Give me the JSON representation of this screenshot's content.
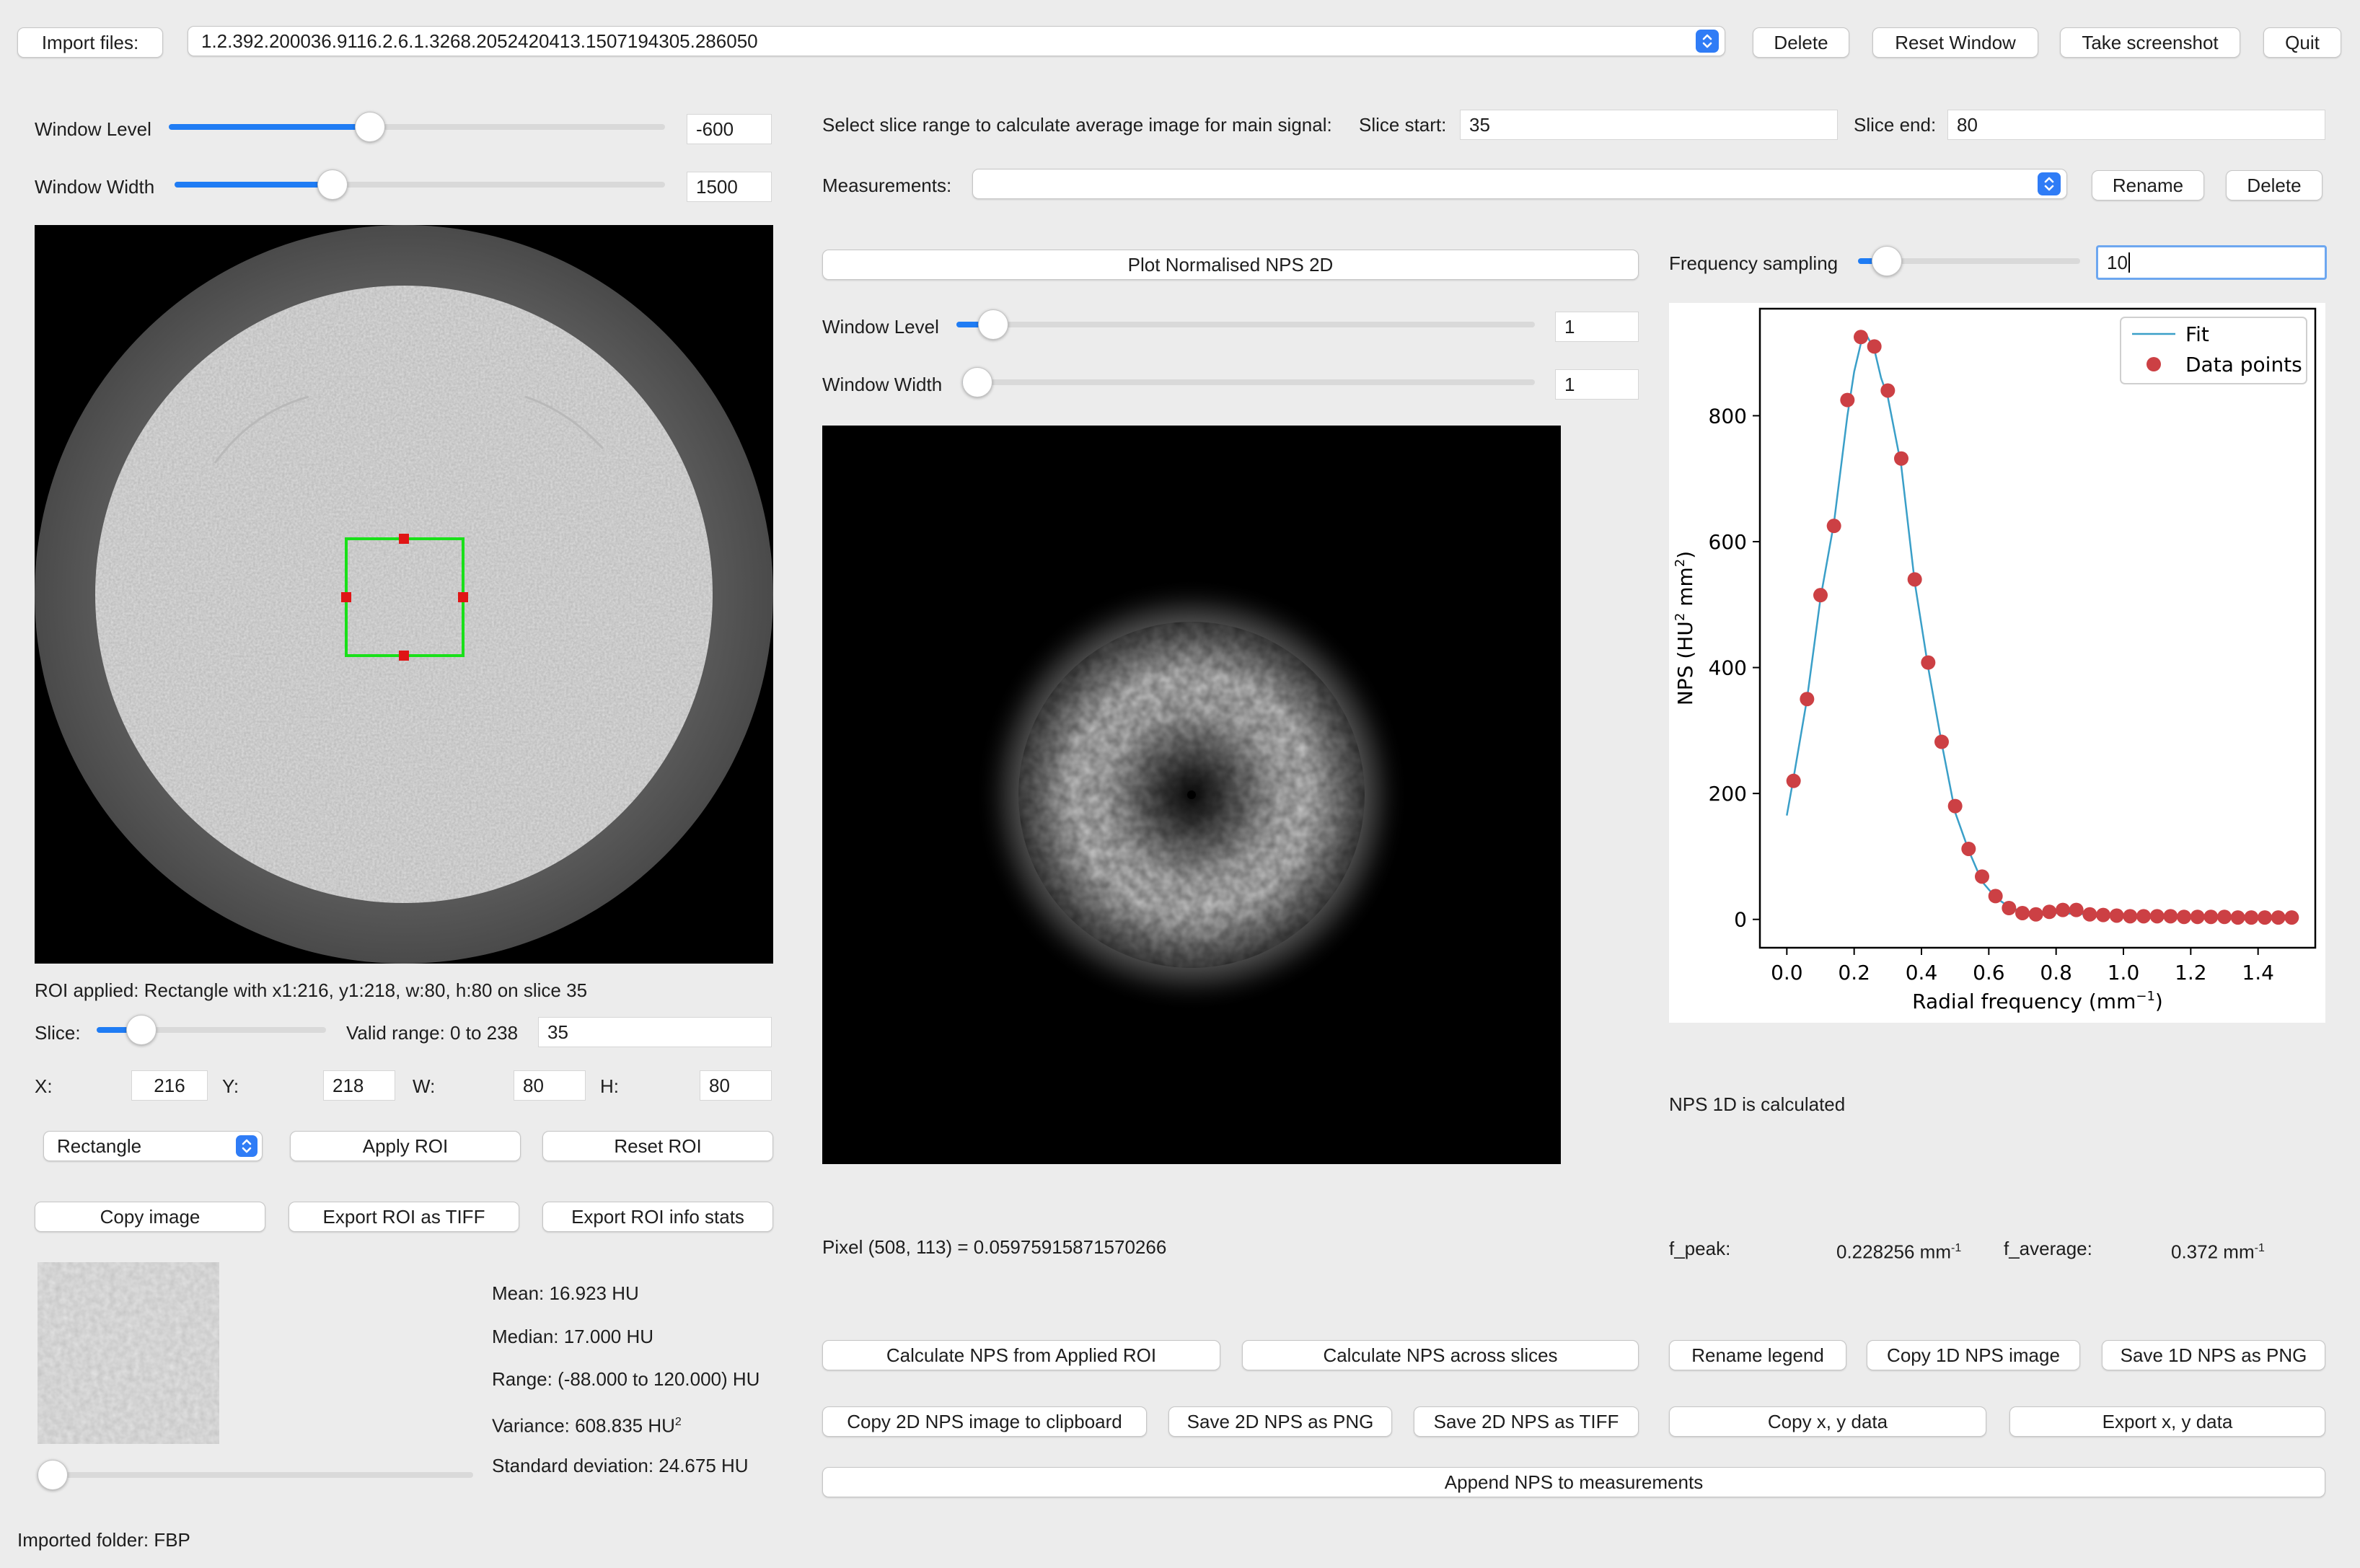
{
  "top_bar": {
    "import_label": "Import files:",
    "file_selected": "1.2.392.200036.9116.2.6.1.3268.2052420413.1507194305.286050",
    "delete_label": "Delete",
    "reset_window_label": "Reset Window",
    "screenshot_label": "Take screenshot",
    "quit_label": "Quit"
  },
  "left": {
    "window_level": {
      "label": "Window Level",
      "value": "-600",
      "slider_fraction": 0.4
    },
    "window_width": {
      "label": "Window Width",
      "value": "1500",
      "slider_fraction": 0.31
    },
    "roi_applied_text": "ROI applied: Rectangle with x1:216, y1:218, w:80, h:80 on slice 35",
    "slice": {
      "label": "Slice:",
      "valid_range": "Valid range: 0 to 238",
      "value": "35",
      "slider_fraction": 0.15
    },
    "coords": {
      "x_label": "X:",
      "x": "216",
      "y_label": "Y:",
      "y": "218",
      "w_label": "W:",
      "w": "80",
      "h_label": "H:",
      "h": "80"
    },
    "shape_select": "Rectangle",
    "apply_roi_label": "Apply ROI",
    "reset_roi_label": "Reset ROI",
    "copy_image_label": "Copy image",
    "export_tiff_label": "Export ROI as TIFF",
    "export_info_label": "Export ROI info  stats",
    "stats": {
      "mean": "Mean: 16.923 HU",
      "median": "Median: 17.000 HU",
      "range": "Range: (-88.000 to 120.000) HU",
      "variance": "Variance: 608.835 HU",
      "variance_sup": "2",
      "std": "Standard deviation: 24.675 HU"
    },
    "preview_slider_fraction": 0.0,
    "imported_folder": "Imported folder: FBP"
  },
  "middle": {
    "slice_range_label": "Select slice range to calculate average image for main signal:",
    "slice_start_label": "Slice start:",
    "slice_start": "35",
    "slice_end_label": "Slice end:",
    "slice_end": "80",
    "measurements_label": "Measurements:",
    "measurements_value": "",
    "rename_label": "Rename",
    "delete_label": "Delete",
    "plot_nps2d_label": "Plot Normalised NPS 2D",
    "window_level": {
      "label": "Window Level",
      "value": "1",
      "slider_fraction": 0.04
    },
    "window_width": {
      "label": "Window Width",
      "value": "1",
      "slider_fraction": 0.0
    },
    "pixel_readout": "Pixel (508, 113) = 0.05975915871570266",
    "calc_roi_label": "Calculate NPS from Applied ROI",
    "calc_slices_label": "Calculate NPS across slices",
    "copy_2d_label": "Copy 2D NPS image to clipboard",
    "save_2d_png_label": "Save 2D NPS as PNG",
    "save_2d_tiff_label": "Save 2D NPS as TIFF",
    "append_label": "Append NPS to measurements"
  },
  "right": {
    "freq_sampling_label": "Frequency sampling",
    "freq_sampling_value": "10",
    "freq_slider_fraction": 0.07,
    "status": "NPS 1D is calculated",
    "f_peak_label": "f_peak:",
    "f_peak_value": "0.228256 mm",
    "f_avg_label": "f_average:",
    "f_avg_value": "0.372 mm",
    "unit_sup": "-1",
    "rename_legend_label": "Rename legend",
    "copy_1d_label": "Copy 1D NPS image",
    "save_1d_label": "Save 1D NPS as PNG",
    "copy_xy_label": "Copy x, y data",
    "export_xy_label": "Export x, y data"
  },
  "chart_data": {
    "type": "line",
    "xlabel": "Radial frequency (mm",
    "xlabel_sup": "−1",
    "xlabel_end": ")",
    "ylabel": "NPS (HU",
    "ylabel_sup1": "2",
    "ylabel_mid": " mm",
    "ylabel_sup2": "2",
    "ylabel_end": ")",
    "xlim": [
      -0.08,
      1.57
    ],
    "ylim": [
      -45,
      970
    ],
    "xticks": [
      "0.0",
      "0.2",
      "0.4",
      "0.6",
      "0.8",
      "1.0",
      "1.2",
      "1.4"
    ],
    "yticks": [
      "0",
      "200",
      "400",
      "600",
      "800"
    ],
    "legend_position": "top-right",
    "fit_color": "#3a9fc8",
    "point_color": "#cc4044",
    "series": [
      {
        "name": "Fit",
        "style": "line",
        "x": [
          0.0,
          0.02,
          0.06,
          0.1,
          0.14,
          0.18,
          0.2,
          0.22,
          0.24,
          0.26,
          0.28,
          0.3,
          0.34,
          0.38,
          0.42,
          0.46,
          0.5,
          0.54,
          0.58,
          0.62,
          0.66,
          0.7,
          0.8,
          0.9,
          1.0,
          1.2,
          1.4,
          1.52
        ],
        "y": [
          165,
          225,
          350,
          510,
          630,
          800,
          870,
          915,
          925,
          905,
          860,
          830,
          720,
          535,
          400,
          280,
          170,
          110,
          60,
          35,
          20,
          12,
          10,
          8,
          6,
          5,
          4,
          3
        ]
      },
      {
        "name": "Data points",
        "style": "points",
        "x": [
          0.02,
          0.06,
          0.1,
          0.14,
          0.18,
          0.22,
          0.26,
          0.3,
          0.34,
          0.38,
          0.42,
          0.46,
          0.5,
          0.54,
          0.58,
          0.62,
          0.66,
          0.7,
          0.74,
          0.78,
          0.82,
          0.86,
          0.9,
          0.94,
          0.98,
          1.02,
          1.06,
          1.1,
          1.14,
          1.18,
          1.22,
          1.26,
          1.3,
          1.34,
          1.38,
          1.42,
          1.46,
          1.5
        ],
        "y": [
          220,
          350,
          515,
          625,
          825,
          925,
          910,
          840,
          732,
          540,
          408,
          282,
          180,
          112,
          68,
          37,
          18,
          10,
          8,
          12,
          15,
          15,
          8,
          7,
          6,
          5,
          5,
          5,
          5,
          4,
          4,
          4,
          4,
          3,
          3,
          3,
          3,
          3
        ]
      }
    ]
  }
}
